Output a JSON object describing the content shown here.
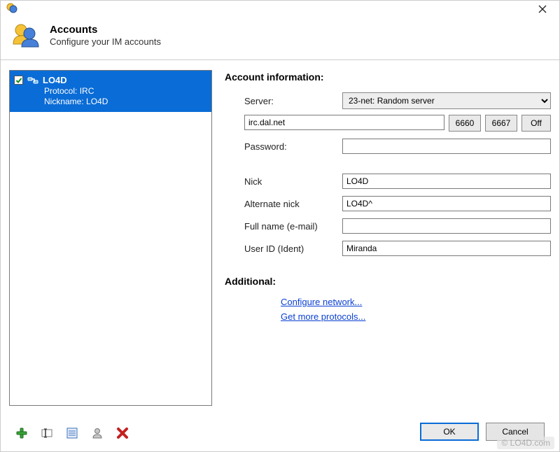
{
  "window": {
    "close": "✕"
  },
  "header": {
    "title": "Accounts",
    "subtitle": "Configure your IM accounts"
  },
  "account_list": {
    "items": [
      {
        "name": "LO4D",
        "protocol_label": "Protocol: IRC",
        "nickname_label": "Nickname: LO4D",
        "checked": true
      }
    ]
  },
  "form": {
    "section": "Account information:",
    "server_label": "Server:",
    "server_selected": "23-net: Random server",
    "server_host": "irc.dal.net",
    "port1": "6660",
    "port2": "6667",
    "off": "Off",
    "password_label": "Password:",
    "password_value": "",
    "nick_label": "Nick",
    "nick_value": "LO4D",
    "altnick_label": "Alternate nick",
    "altnick_value": "LO4D^",
    "fullname_label": "Full name (e-mail)",
    "fullname_value": "",
    "userid_label": "User ID (Ident)",
    "userid_value": "Miranda",
    "additional": "Additional:",
    "link_configure": "Configure network...",
    "link_protocols": "Get more protocols..."
  },
  "buttons": {
    "ok": "OK",
    "cancel": "Cancel"
  },
  "toolbar_icons": {
    "add": "plus-icon",
    "rename": "rename-icon",
    "options": "options-icon",
    "user": "user-icon",
    "delete": "delete-icon"
  },
  "watermark": "© LO4D.com"
}
